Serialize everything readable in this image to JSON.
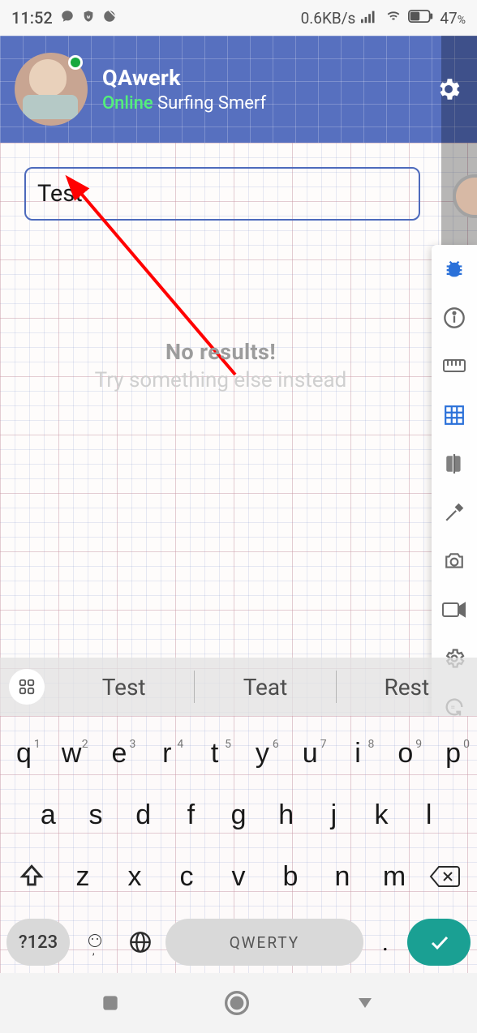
{
  "status": {
    "time": "11:52",
    "net_speed": "0.6KB/s",
    "battery_pct": "47",
    "pct_sym": "%"
  },
  "header": {
    "name": "QAwerk",
    "online_label": "Online",
    "subtitle_rest": " Surfing Smerf"
  },
  "search": {
    "value": "Test"
  },
  "empty": {
    "title": "No results!",
    "subtitle": "Try something else instead"
  },
  "suggestions": {
    "items": [
      "Test",
      "Teat",
      "Rest"
    ]
  },
  "keyboard": {
    "row1": [
      {
        "k": "q",
        "n": "1"
      },
      {
        "k": "w",
        "n": "2"
      },
      {
        "k": "e",
        "n": "3"
      },
      {
        "k": "r",
        "n": "4"
      },
      {
        "k": "t",
        "n": "5"
      },
      {
        "k": "y",
        "n": "6"
      },
      {
        "k": "u",
        "n": "7"
      },
      {
        "k": "i",
        "n": "8"
      },
      {
        "k": "o",
        "n": "9"
      },
      {
        "k": "p",
        "n": "0"
      }
    ],
    "row2": [
      "a",
      "s",
      "d",
      "f",
      "g",
      "h",
      "j",
      "k",
      "l"
    ],
    "row3": [
      "z",
      "x",
      "c",
      "v",
      "b",
      "n",
      "m"
    ],
    "sym_label": "?123",
    "space_label": "QWERTY",
    "dot": "."
  },
  "emoji_punct": ","
}
